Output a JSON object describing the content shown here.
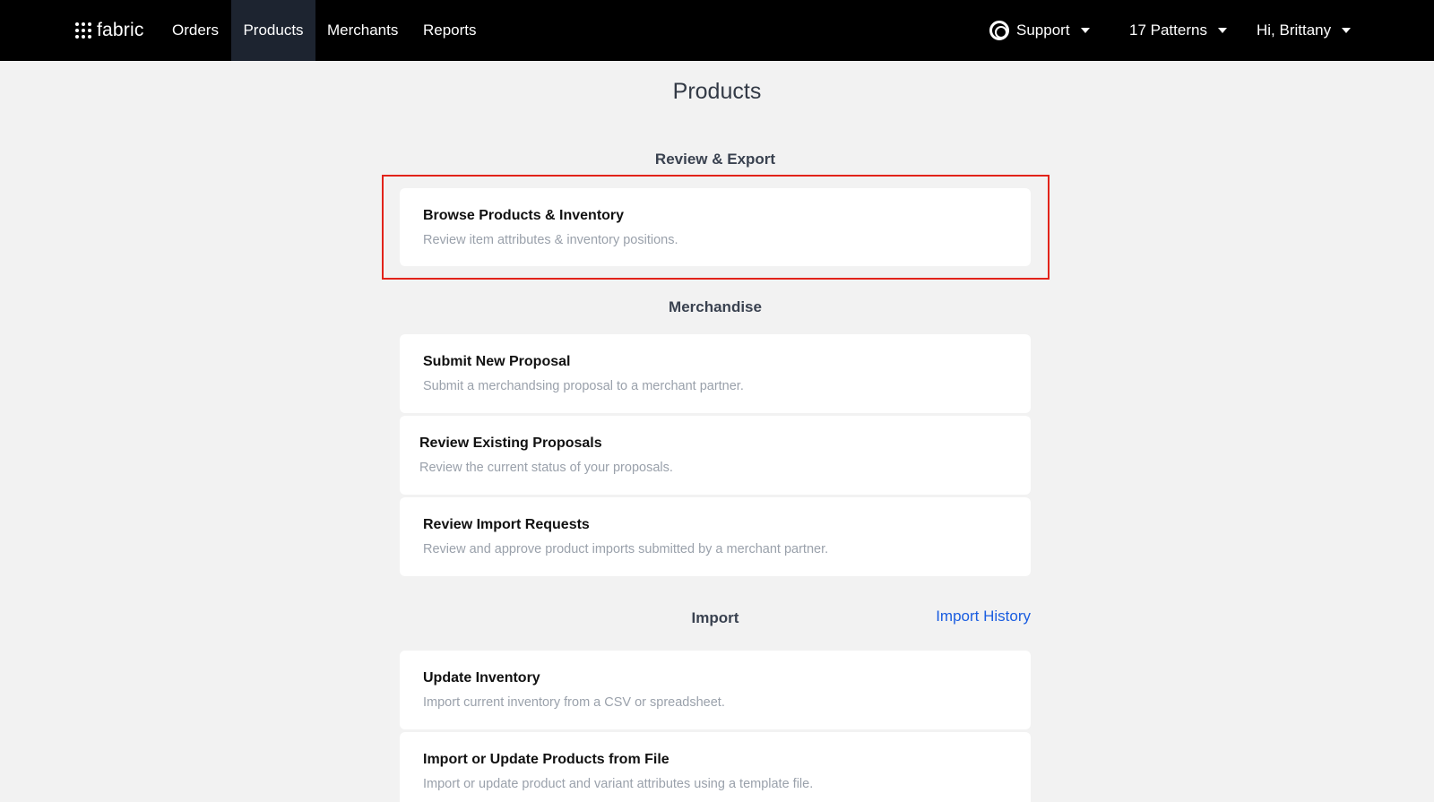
{
  "topbar": {
    "brand": "fabric",
    "nav": [
      "Orders",
      "Products",
      "Merchants",
      "Reports"
    ],
    "active_nav": "Products",
    "support_label": "Support",
    "org_label": "17 Patterns",
    "user_label": "Hi, Brittany"
  },
  "page": {
    "title": "Products"
  },
  "sections": {
    "review_export": {
      "heading": "Review & Export",
      "cards": [
        {
          "title": "Browse Products & Inventory",
          "desc": "Review item attributes & inventory positions."
        }
      ]
    },
    "merchandise": {
      "heading": "Merchandise",
      "cards": [
        {
          "title": "Submit New Proposal",
          "desc": "Submit a merchandsing proposal to a merchant partner."
        },
        {
          "title": "Review Existing Proposals",
          "desc": "Review the current status of your proposals."
        },
        {
          "title": "Review Import Requests",
          "desc": "Review and approve product imports submitted by a merchant partner."
        }
      ]
    },
    "import": {
      "heading": "Import",
      "history_link": "Import History",
      "cards": [
        {
          "title": "Update Inventory",
          "desc": "Import current inventory from a CSV or spreadsheet."
        },
        {
          "title": "Import or Update Products from File",
          "desc": "Import or update product and variant attributes using a template file."
        }
      ]
    }
  },
  "colors": {
    "topbar_bg": "#000000",
    "active_nav_bg": "#1d2430",
    "page_bg": "#f2f2f2",
    "link": "#1a5de0",
    "highlight": "#e2231a"
  },
  "icons": {
    "brand": "dots-grid-icon",
    "support": "lifebuoy-icon",
    "dropdown": "caret-down-icon"
  }
}
